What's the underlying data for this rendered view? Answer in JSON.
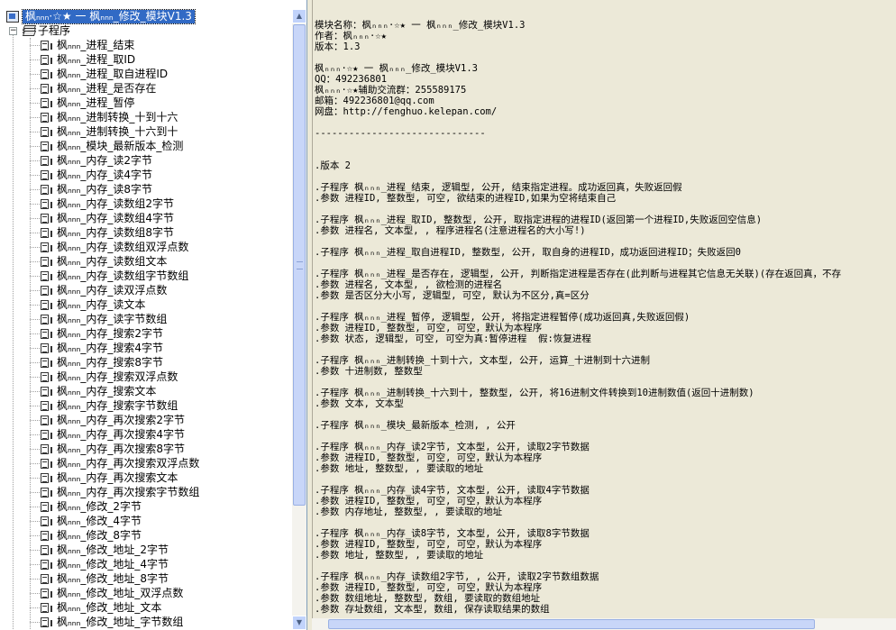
{
  "tree": {
    "root_label": "枫ₙₙₙ·☆★ 一 枫ₙₙₙ_修改_模块V1.3",
    "group_label": "子程序",
    "items": [
      "枫ₙₙₙ_进程_结束",
      "枫ₙₙₙ_进程_取ID",
      "枫ₙₙₙ_进程_取自进程ID",
      "枫ₙₙₙ_进程_是否存在",
      "枫ₙₙₙ_进程_暂停",
      "枫ₙₙₙ_进制转换_十到十六",
      "枫ₙₙₙ_进制转换_十六到十",
      "枫ₙₙₙ_模块_最新版本_检测",
      "枫ₙₙₙ_内存_读2字节",
      "枫ₙₙₙ_内存_读4字节",
      "枫ₙₙₙ_内存_读8字节",
      "枫ₙₙₙ_内存_读数组2字节",
      "枫ₙₙₙ_内存_读数组4字节",
      "枫ₙₙₙ_内存_读数组8字节",
      "枫ₙₙₙ_内存_读数组双浮点数",
      "枫ₙₙₙ_内存_读数组文本",
      "枫ₙₙₙ_内存_读数组字节数组",
      "枫ₙₙₙ_内存_读双浮点数",
      "枫ₙₙₙ_内存_读文本",
      "枫ₙₙₙ_内存_读字节数组",
      "枫ₙₙₙ_内存_搜索2字节",
      "枫ₙₙₙ_内存_搜索4字节",
      "枫ₙₙₙ_内存_搜索8字节",
      "枫ₙₙₙ_内存_搜索双浮点数",
      "枫ₙₙₙ_内存_搜索文本",
      "枫ₙₙₙ_内存_搜索字节数组",
      "枫ₙₙₙ_内存_再次搜索2字节",
      "枫ₙₙₙ_内存_再次搜索4字节",
      "枫ₙₙₙ_内存_再次搜索8字节",
      "枫ₙₙₙ_内存_再次搜索双浮点数",
      "枫ₙₙₙ_内存_再次搜索文本",
      "枫ₙₙₙ_内存_再次搜索字节数组",
      "枫ₙₙₙ_修改_2字节",
      "枫ₙₙₙ_修改_4字节",
      "枫ₙₙₙ_修改_8字节",
      "枫ₙₙₙ_修改_地址_2字节",
      "枫ₙₙₙ_修改_地址_4字节",
      "枫ₙₙₙ_修改_地址_8字节",
      "枫ₙₙₙ_修改_地址_双浮点数",
      "枫ₙₙₙ_修改_地址_文本",
      "枫ₙₙₙ_修改_地址_字节数组"
    ]
  },
  "text_lines": [
    "模块名称：枫ₙₙₙ·☆★ 一 枫ₙₙₙ_修改_模块V1.3",
    "作者：枫ₙₙₙ·☆★",
    "版本：1.3",
    "",
    "枫ₙₙₙ·☆★ 一 枫ₙₙₙ_修改_模块V1.3",
    "QQ：492236801",
    "枫ₙₙₙ·☆★辅助交流群：255589175",
    "邮箱：492236801@qq.com",
    "网盘：http://fenghuo.kelepan.com/",
    "",
    "------------------------------",
    "",
    "",
    ".版本 2",
    "",
    ".子程序 枫ₙₙₙ_进程_结束, 逻辑型, 公开, 结束指定进程。成功返回真，失败返回假",
    ".参数 进程ID, 整数型, 可空, 欲结束的进程ID,如果为空将结束自己",
    "",
    ".子程序 枫ₙₙₙ_进程_取ID, 整数型, 公开, 取指定进程的进程ID(返回第一个进程ID,失败返回空信息)",
    ".参数 进程名, 文本型, , 程序进程名(注意进程名的大小写!)",
    "",
    ".子程序 枫ₙₙₙ_进程_取自进程ID, 整数型, 公开, 取自身的进程ID，成功返回进程ID；失败返回0",
    "",
    ".子程序 枫ₙₙₙ_进程_是否存在, 逻辑型, 公开, 判断指定进程是否存在(此判断与进程其它信息无关联)(存在返回真，不存",
    ".参数 进程名, 文本型, , 欲检测的进程名",
    ".参数 是否区分大小写, 逻辑型, 可空, 默认为不区分,真=区分",
    "",
    ".子程序 枫ₙₙₙ_进程_暂停, 逻辑型, 公开, 将指定进程暂停(成功返回真,失败返回假)",
    ".参数 进程ID, 整数型, 可空, 可空，默认为本程序",
    ".参数 状态, 逻辑型, 可空, 可空为真:暂停进程  假:恢复进程",
    "",
    ".子程序 枫ₙₙₙ_进制转换_十到十六, 文本型, 公开, 运算_十进制到十六进制",
    ".参数 十进制数, 整数型",
    "",
    ".子程序 枫ₙₙₙ_进制转换_十六到十, 整数型, 公开, 将16进制文件转换到10进制数值(返回十进制数)",
    ".参数 文本, 文本型",
    "",
    ".子程序 枫ₙₙₙ_模块_最新版本_检测, , 公开",
    "",
    ".子程序 枫ₙₙₙ_内存_读2字节, 文本型, 公开, 读取2字节数据",
    ".参数 进程ID, 整数型, 可空, 可空，默认为本程序",
    ".参数 地址, 整数型, , 要读取的地址",
    "",
    ".子程序 枫ₙₙₙ_内存_读4字节, 文本型, 公开, 读取4字节数据",
    ".参数 进程ID, 整数型, 可空, 可空，默认为本程序",
    ".参数 内存地址, 整数型, , 要读取的地址",
    "",
    ".子程序 枫ₙₙₙ_内存_读8字节, 文本型, 公开, 读取8字节数据",
    ".参数 进程ID, 整数型, 可空, 可空，默认为本程序",
    ".参数 地址, 整数型, , 要读取的地址",
    "",
    ".子程序 枫ₙₙₙ_内存_读数组2字节, , 公开, 读取2字节数组数据",
    ".参数 进程ID, 整数型, 可空, 可空，默认为本程序",
    ".参数 数组地址, 整数型, 数组, 要读取的数组地址",
    ".参数 存址数组, 文本型, 数组, 保存读取结果的数组"
  ]
}
